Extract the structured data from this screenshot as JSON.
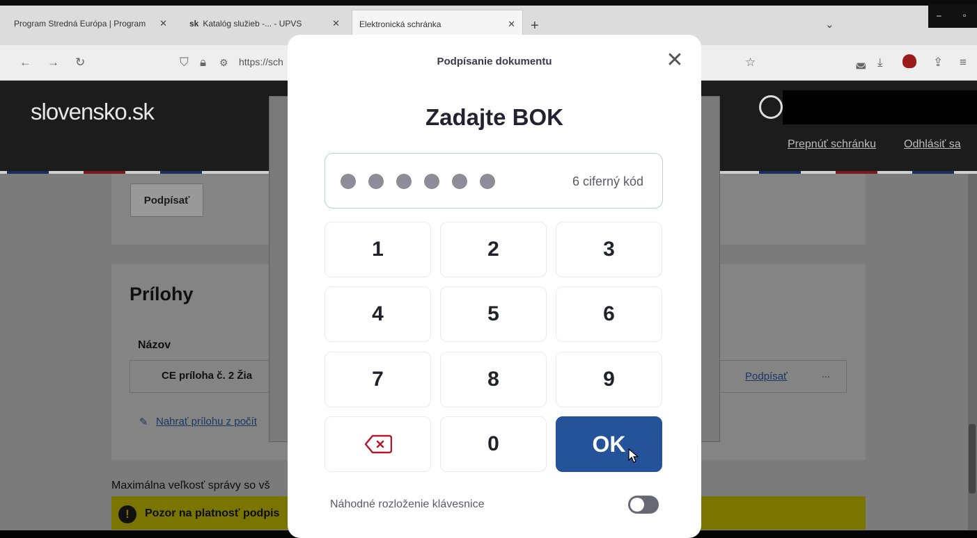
{
  "browser": {
    "tabs": [
      {
        "label": "Program Stredná Európa | Program"
      },
      {
        "label": "Katalóg služieb -... - UPVS"
      },
      {
        "label": "Elektronická schránka"
      }
    ],
    "url": "https://sch"
  },
  "site": {
    "logo": "slovensko.sk",
    "links": [
      "Prepnúť schránku",
      "Odhlásiť sa"
    ],
    "sign_button": "Podpísať",
    "attachments_title": "Prílohy",
    "column_name": "Názov",
    "row_text": "CE príloha č. 2 Žia",
    "row_sign": "Podpísať",
    "row_more": "...",
    "upload_link": "Nahrať prílohu z počít",
    "max_size_text": "Maximálna veľkosť správy so vš",
    "warning_text": "Pozor na platnosť podpis"
  },
  "modal": {
    "title": "Podpísanie dokumentu",
    "heading": "Zadajte BOK",
    "code_hint": "6 ciferný kód",
    "entered_digits": 6,
    "keys": [
      "1",
      "2",
      "3",
      "4",
      "5",
      "6",
      "7",
      "8",
      "9",
      "0"
    ],
    "ok_label": "OK",
    "random_layout_label": "Náhodné rozloženie klávesnice",
    "random_layout_enabled": true
  },
  "colors": {
    "ok_button": "#24539a",
    "backspace_icon": "#b5172c",
    "warning_bar": "#d4c800"
  }
}
